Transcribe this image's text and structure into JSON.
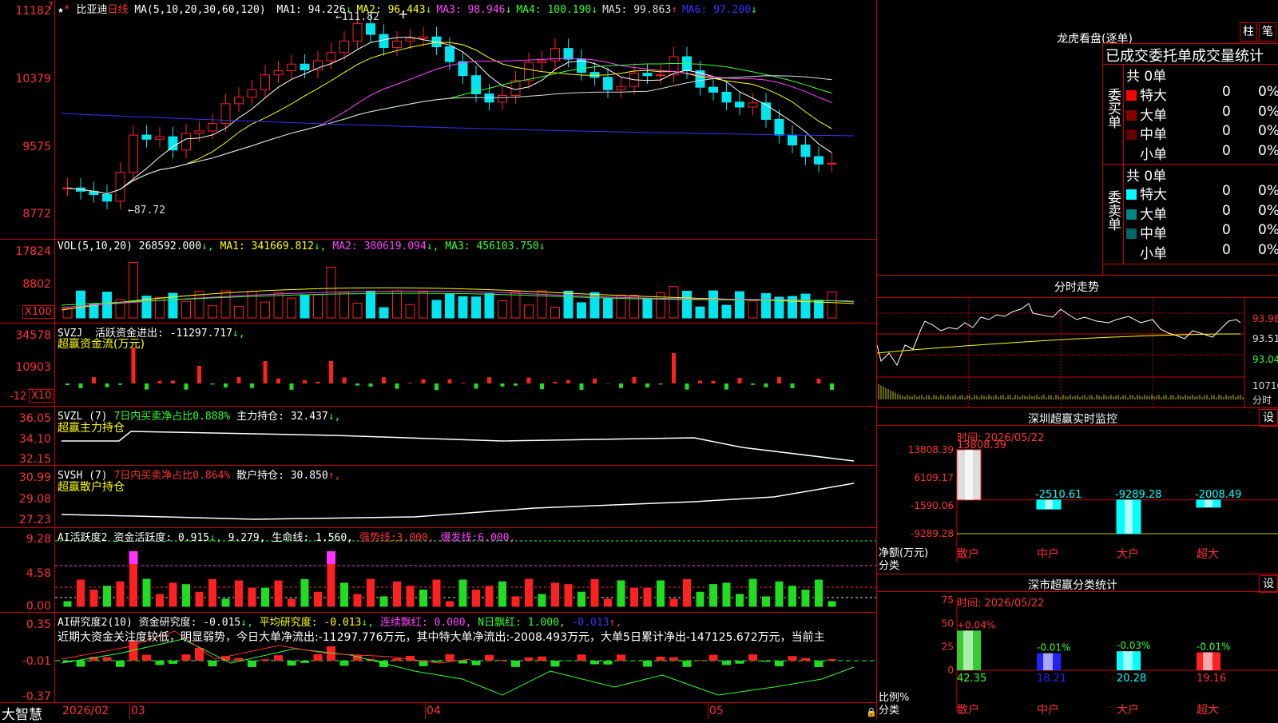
{
  "left": {
    "price_panel": {
      "stock_name": "比亚迪",
      "period": "日线",
      "ma_label": "MA(5,10,20,30,60,120)",
      "ma_values": [
        {
          "label": "MA1:",
          "value": "94.226",
          "arrow": "↓",
          "color": "#ffffff"
        },
        {
          "label": "MA2:",
          "value": "96.443",
          "arrow": "↓",
          "color": "#ffff00"
        },
        {
          "label": "MA3:",
          "value": "98.946",
          "arrow": "↓",
          "color": "#ff44ff"
        },
        {
          "label": "MA4:",
          "value": "100.190",
          "arrow": "↓",
          "color": "#33ff33"
        },
        {
          "label": "MA5:",
          "value": "99.863",
          "arrow": "↑",
          "color": "#dddddd"
        },
        {
          "label": "MA6:",
          "value": "97.200",
          "arrow": "↓",
          "color": "#3333ff"
        }
      ],
      "y_ticks": [
        "11182",
        "10379",
        "9575",
        "8772"
      ],
      "high_label": "111.82",
      "low_label": "87.72",
      "top_marker": "?"
    },
    "vol_panel": {
      "title": "VOL(5,10,20)",
      "value": "268592.000",
      "ma1": "341669.812",
      "ma2": "380619.094",
      "ma3": "456103.750",
      "y_ticks": [
        "17824",
        "8802"
      ],
      "unit": "X100"
    },
    "svzj_panel": {
      "title": "SVZJ",
      "subtitle": "活跃资金进出:",
      "value": "-11297.717",
      "label2": "超赢资金流(万元)",
      "y_ticks": [
        "34578",
        "10903",
        "-12"
      ],
      "unit": "X10"
    },
    "svzl_panel": {
      "title": "SVZL (7)",
      "t1": "7日内买卖净占比0.888%",
      "t2": "主力持仓:",
      "t2v": "32.437",
      "label2": "超赢主力持仓",
      "y_ticks": [
        "36.05",
        "34.10",
        "32.15"
      ]
    },
    "svsh_panel": {
      "title": "SVSH (7)",
      "t1": "7日内买卖净占比0.864%",
      "t2": "散户持仓:",
      "t2v": "30.850",
      "label2": "超赢散户持仓",
      "y_ticks": [
        "30.99",
        "29.08",
        "27.23"
      ]
    },
    "ai1_panel": {
      "title": "AI活跃度2",
      "t1": "资金活跃度:",
      "t1v": "0.915",
      "t1v2": "9.279,",
      "t2": "生命线:",
      "t2v": "1.560,",
      "t3": "强势线:",
      "t3v": "3.000,",
      "t4": "爆发线:",
      "t4v": "6.000,",
      "y_ticks": [
        "9.28",
        "4.58",
        "0.00"
      ]
    },
    "ai2_panel": {
      "title": "AI研究度2(10)",
      "t1": "资金研究度:",
      "t1v": "-0.015",
      "t2": "平均研究度:",
      "t2v": "-0.013",
      "t3": "连续飘红:",
      "t3v": "0.000,",
      "t4": "N日飘红:",
      "t4v": "1.000,",
      "t5v": "-0.013",
      "comment": "近期大资金关注度较低，明显弱势，今日大单净流出:-11297.776万元，其中特大单净流出:-2008.493万元，大单5日累计净出-147125.672万元，当前主",
      "y_ticks": [
        "0.35",
        "-0.01",
        "-0.37"
      ]
    },
    "bottom": {
      "brand": "大智慧",
      "date_start": "2026/02",
      "month_labels": [
        "03",
        "04",
        "05"
      ]
    }
  },
  "right": {
    "longhu": {
      "title": "龙虎看盘(逐单)",
      "btn1": "柱",
      "btn2": "笔",
      "tabs": "已成交委托单成交量统计",
      "buy": {
        "side_label": "委买单",
        "total": "共 0单",
        "rows": [
          {
            "name": "特大",
            "color": "#ff0000",
            "count": "0",
            "pct": "0%"
          },
          {
            "name": "大单",
            "color": "#880000",
            "count": "0",
            "pct": "0%"
          },
          {
            "name": "中单",
            "color": "#660000",
            "count": "0",
            "pct": "0%"
          },
          {
            "name": "小单",
            "color": "",
            "count": "0",
            "pct": "0%"
          }
        ]
      },
      "sell": {
        "side_label": "委卖单",
        "total": "共 0单",
        "rows": [
          {
            "name": "特大",
            "color": "#00ffff",
            "count": "0",
            "pct": "0%"
          },
          {
            "name": "大单",
            "color": "#008888",
            "count": "0",
            "pct": "0%"
          },
          {
            "name": "中单",
            "color": "#006666",
            "count": "0",
            "pct": "0%"
          },
          {
            "name": "小单",
            "color": "",
            "count": "0",
            "pct": "0%"
          }
        ]
      }
    },
    "intraday": {
      "title": "分时走势",
      "y_ticks": [
        "93.98",
        "93.51",
        "93.04"
      ],
      "vol_tick": "10710",
      "vol_label": "分时"
    },
    "monitor": {
      "title": "深圳超赢实时监控",
      "settings": "设",
      "time": "时间: 2026/05/22",
      "y_ticks": [
        "13808.39",
        "6109.17",
        "-1590.06",
        "-9289.28"
      ],
      "y_label1": "净额(万元)",
      "y_label2": "分类",
      "bars": [
        {
          "cat": "散户",
          "value": "13808.39",
          "v": 13808.39
        },
        {
          "cat": "中户",
          "value": "-2510.61",
          "v": -2510.61
        },
        {
          "cat": "大户",
          "value": "-9289.28",
          "v": -9289.28
        },
        {
          "cat": "超大",
          "value": "-2008.49",
          "v": -2008.49
        }
      ]
    },
    "classify": {
      "title": "深市超赢分类统计",
      "settings": "设",
      "time": "时间: 2026/05/22",
      "y_ticks": [
        "75",
        "50",
        "25",
        "0"
      ],
      "y_label1": "比例%",
      "y_label2": "分类",
      "bars": [
        {
          "cat": "散户",
          "change": "+0.04%",
          "value": "42.35",
          "v": 42.35,
          "color": "#33cc33"
        },
        {
          "cat": "中户",
          "change": "-0.01%",
          "value": "18.21",
          "v": 18.21,
          "color": "#2222ff"
        },
        {
          "cat": "大户",
          "change": "-0.03%",
          "value": "20.28",
          "v": 20.28,
          "color": "#00ffff"
        },
        {
          "cat": "超大",
          "change": "-0.01%",
          "value": "19.16",
          "v": 19.16,
          "color": "#ff2222"
        }
      ]
    }
  }
}
